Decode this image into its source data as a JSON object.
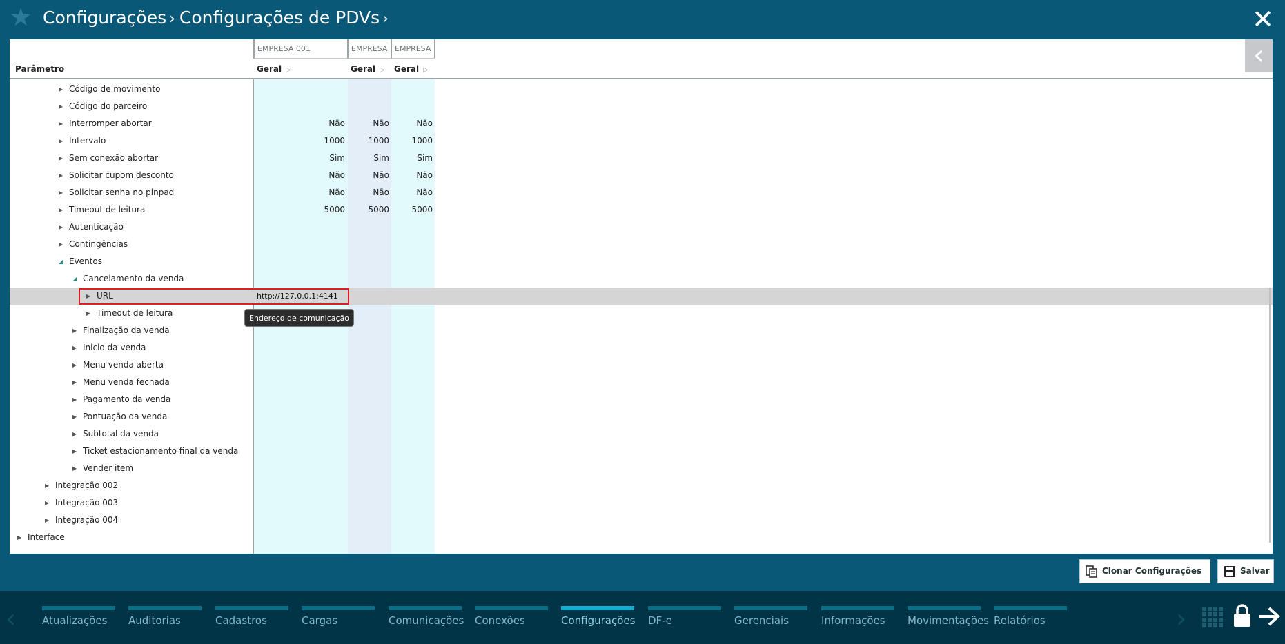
{
  "header": {
    "breadcrumb": [
      "Configurações",
      "Configurações de PDVs"
    ]
  },
  "table": {
    "col_headers": [
      "EMPRESA 001",
      "EMPRESA",
      "EMPRESA"
    ],
    "param_header": "Parâmetro",
    "geral_label": "Geral",
    "rows": [
      {
        "label": "Código de movimento",
        "level": 3,
        "expanded": false,
        "values": [
          "",
          "",
          ""
        ]
      },
      {
        "label": "Código do parceiro",
        "level": 3,
        "expanded": false,
        "values": [
          "",
          "",
          ""
        ]
      },
      {
        "label": "Interromper abortar",
        "level": 3,
        "expanded": false,
        "values": [
          "Não",
          "Não",
          "Não"
        ]
      },
      {
        "label": "Intervalo",
        "level": 3,
        "expanded": false,
        "values": [
          "1000",
          "1000",
          "1000"
        ]
      },
      {
        "label": "Sem conexão abortar",
        "level": 3,
        "expanded": false,
        "values": [
          "Sim",
          "Sim",
          "Sim"
        ]
      },
      {
        "label": "Solicitar cupom desconto",
        "level": 3,
        "expanded": false,
        "values": [
          "Não",
          "Não",
          "Não"
        ]
      },
      {
        "label": "Solicitar senha no pinpad",
        "level": 3,
        "expanded": false,
        "values": [
          "Não",
          "Não",
          "Não"
        ]
      },
      {
        "label": "Timeout de leitura",
        "level": 3,
        "expanded": false,
        "values": [
          "5000",
          "5000",
          "5000"
        ]
      },
      {
        "label": "Autenticação",
        "level": 3,
        "expanded": false,
        "values": [
          "",
          "",
          ""
        ]
      },
      {
        "label": "Contingências",
        "level": 3,
        "expanded": false,
        "values": [
          "",
          "",
          ""
        ]
      },
      {
        "label": "Eventos",
        "level": 3,
        "expanded": true,
        "values": [
          "",
          "",
          ""
        ]
      },
      {
        "label": "Cancelamento da venda",
        "level": 4,
        "expanded": true,
        "values": [
          "",
          "",
          ""
        ]
      },
      {
        "label": "URL",
        "level": 5,
        "expanded": false,
        "selected": true,
        "url": "http://127.0.0.1:4141",
        "values": [
          "",
          "",
          ""
        ]
      },
      {
        "label": "Timeout de leitura",
        "level": 5,
        "expanded": false,
        "values": [
          "",
          "",
          ""
        ]
      },
      {
        "label": "Finalização da venda",
        "level": 4,
        "expanded": false,
        "values": [
          "",
          "",
          ""
        ]
      },
      {
        "label": "Inicio da venda",
        "level": 4,
        "expanded": false,
        "values": [
          "",
          "",
          ""
        ]
      },
      {
        "label": "Menu venda aberta",
        "level": 4,
        "expanded": false,
        "values": [
          "",
          "",
          ""
        ]
      },
      {
        "label": "Menu venda fechada",
        "level": 4,
        "expanded": false,
        "values": [
          "",
          "",
          ""
        ]
      },
      {
        "label": "Pagamento da venda",
        "level": 4,
        "expanded": false,
        "values": [
          "",
          "",
          ""
        ]
      },
      {
        "label": "Pontuação da venda",
        "level": 4,
        "expanded": false,
        "values": [
          "",
          "",
          ""
        ]
      },
      {
        "label": "Subtotal da venda",
        "level": 4,
        "expanded": false,
        "values": [
          "",
          "",
          ""
        ]
      },
      {
        "label": "Ticket estacionamento final da venda",
        "level": 4,
        "expanded": false,
        "values": [
          "",
          "",
          ""
        ]
      },
      {
        "label": "Vender item",
        "level": 4,
        "expanded": false,
        "values": [
          "",
          "",
          ""
        ]
      },
      {
        "label": "Integração 002",
        "level": 2,
        "expanded": false,
        "values": [
          "",
          "",
          ""
        ]
      },
      {
        "label": "Integração 003",
        "level": 2,
        "expanded": false,
        "values": [
          "",
          "",
          ""
        ]
      },
      {
        "label": "Integração 004",
        "level": 2,
        "expanded": false,
        "values": [
          "",
          "",
          ""
        ]
      },
      {
        "label": "Interface",
        "level": 0,
        "expanded": false,
        "values": [
          "",
          "",
          ""
        ]
      }
    ]
  },
  "tooltip": "Endereço de comunicação",
  "buttons": {
    "clone": "Clonar Configurações",
    "save": "Salvar"
  },
  "nav": {
    "items": [
      "Atualizações",
      "Auditorias",
      "Cadastros",
      "Cargas",
      "Comunicações",
      "Conexões",
      "Configurações",
      "DF-e",
      "Gerenciais",
      "Informações",
      "Movimentações",
      "Relatórios"
    ],
    "active": "Configurações"
  }
}
